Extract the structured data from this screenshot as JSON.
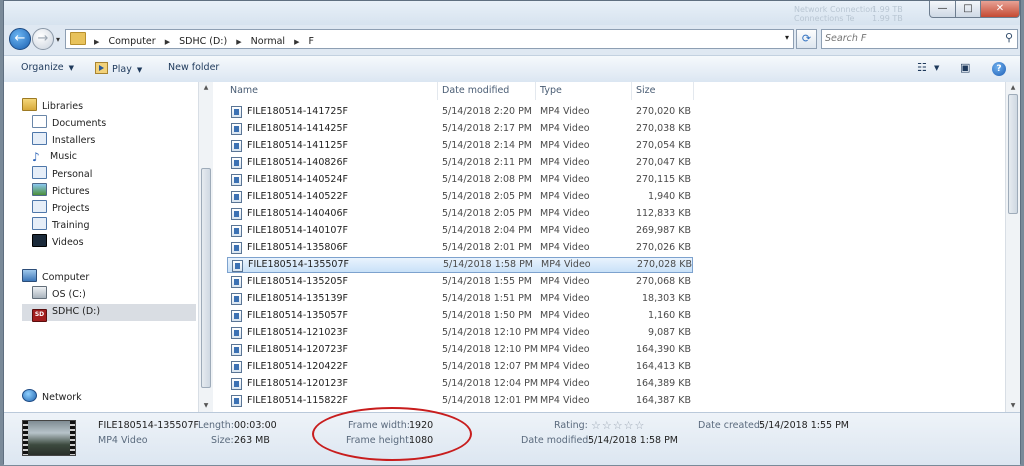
{
  "window": {
    "background_texts": [
      "Network Connection",
      "Connections Te",
      "1.99 TB",
      "1.99 TB"
    ],
    "controls": {
      "minimize": "—",
      "maximize": "□",
      "close": "✕"
    }
  },
  "address_bar": {
    "crumbs": [
      "Computer",
      "SDHC (D:)",
      "Normal",
      "F"
    ],
    "search_placeholder": "Search F"
  },
  "toolbar": {
    "organize": "Organize",
    "play": "Play",
    "new_folder": "New folder"
  },
  "nav": {
    "libraries": "Libraries",
    "library_items": [
      "Documents",
      "Installers",
      "Music",
      "Personal",
      "Pictures",
      "Projects",
      "Training",
      "Videos"
    ],
    "computer": "Computer",
    "drives": [
      "OS (C:)",
      "SDHC (D:)"
    ],
    "network": "Network"
  },
  "columns": {
    "name": "Name",
    "date": "Date modified",
    "type": "Type",
    "size": "Size"
  },
  "files": [
    {
      "name": "FILE180514-141725F",
      "date": "5/14/2018 2:20 PM",
      "type": "MP4 Video",
      "size": "270,020 KB"
    },
    {
      "name": "FILE180514-141425F",
      "date": "5/14/2018 2:17 PM",
      "type": "MP4 Video",
      "size": "270,038 KB"
    },
    {
      "name": "FILE180514-141125F",
      "date": "5/14/2018 2:14 PM",
      "type": "MP4 Video",
      "size": "270,054 KB"
    },
    {
      "name": "FILE180514-140826F",
      "date": "5/14/2018 2:11 PM",
      "type": "MP4 Video",
      "size": "270,047 KB"
    },
    {
      "name": "FILE180514-140524F",
      "date": "5/14/2018 2:08 PM",
      "type": "MP4 Video",
      "size": "270,115 KB"
    },
    {
      "name": "FILE180514-140522F",
      "date": "5/14/2018 2:05 PM",
      "type": "MP4 Video",
      "size": "1,940 KB"
    },
    {
      "name": "FILE180514-140406F",
      "date": "5/14/2018 2:05 PM",
      "type": "MP4 Video",
      "size": "112,833 KB"
    },
    {
      "name": "FILE180514-140107F",
      "date": "5/14/2018 2:04 PM",
      "type": "MP4 Video",
      "size": "269,987 KB"
    },
    {
      "name": "FILE180514-135806F",
      "date": "5/14/2018 2:01 PM",
      "type": "MP4 Video",
      "size": "270,026 KB"
    },
    {
      "name": "FILE180514-135507F",
      "date": "5/14/2018 1:58 PM",
      "type": "MP4 Video",
      "size": "270,028 KB",
      "selected": true
    },
    {
      "name": "FILE180514-135205F",
      "date": "5/14/2018 1:55 PM",
      "type": "MP4 Video",
      "size": "270,068 KB"
    },
    {
      "name": "FILE180514-135139F",
      "date": "5/14/2018 1:51 PM",
      "type": "MP4 Video",
      "size": "18,303 KB"
    },
    {
      "name": "FILE180514-135057F",
      "date": "5/14/2018 1:50 PM",
      "type": "MP4 Video",
      "size": "1,160 KB"
    },
    {
      "name": "FILE180514-121023F",
      "date": "5/14/2018 12:10 PM",
      "type": "MP4 Video",
      "size": "9,087 KB"
    },
    {
      "name": "FILE180514-120723F",
      "date": "5/14/2018 12:10 PM",
      "type": "MP4 Video",
      "size": "164,390 KB"
    },
    {
      "name": "FILE180514-120422F",
      "date": "5/14/2018 12:07 PM",
      "type": "MP4 Video",
      "size": "164,413 KB"
    },
    {
      "name": "FILE180514-120123F",
      "date": "5/14/2018 12:04 PM",
      "type": "MP4 Video",
      "size": "164,389 KB"
    },
    {
      "name": "FILE180514-115822F",
      "date": "5/14/2018 12:01 PM",
      "type": "MP4 Video",
      "size": "164,387 KB"
    }
  ],
  "details": {
    "filename": "FILE180514-135507F",
    "filetype": "MP4 Video",
    "length_label": "Length:",
    "length": "00:03:00",
    "size_label": "Size:",
    "size": "263 MB",
    "frame_width_label": "Frame width:",
    "frame_width": "1920",
    "frame_height_label": "Frame height:",
    "frame_height": "1080",
    "rating_label": "Rating:",
    "rating_stars": "☆☆☆☆☆",
    "date_modified_label": "Date modified:",
    "date_modified": "5/14/2018 1:58 PM",
    "date_created_label": "Date created:",
    "date_created": "5/14/2018 1:55 PM"
  },
  "colors": {
    "selection": "#c9e1f8",
    "annotation": "#c81d1d"
  }
}
